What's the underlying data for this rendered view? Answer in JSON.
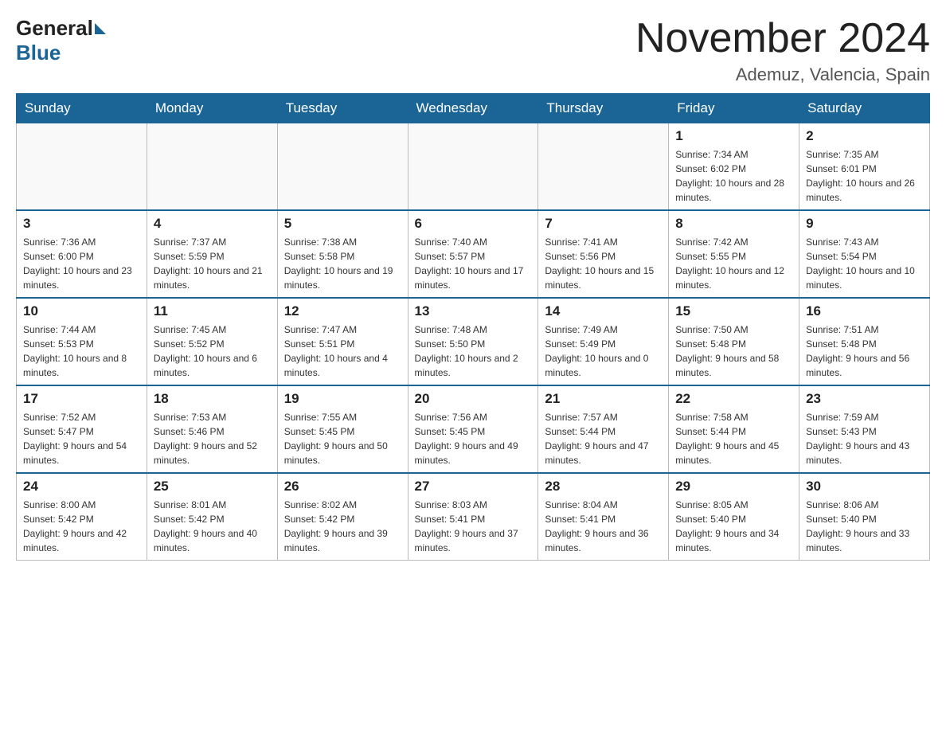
{
  "header": {
    "logo_general": "General",
    "logo_blue": "Blue",
    "title": "November 2024",
    "subtitle": "Ademuz, Valencia, Spain"
  },
  "days_of_week": [
    "Sunday",
    "Monday",
    "Tuesday",
    "Wednesday",
    "Thursday",
    "Friday",
    "Saturday"
  ],
  "weeks": [
    [
      {
        "day": "",
        "info": ""
      },
      {
        "day": "",
        "info": ""
      },
      {
        "day": "",
        "info": ""
      },
      {
        "day": "",
        "info": ""
      },
      {
        "day": "",
        "info": ""
      },
      {
        "day": "1",
        "info": "Sunrise: 7:34 AM\nSunset: 6:02 PM\nDaylight: 10 hours and 28 minutes."
      },
      {
        "day": "2",
        "info": "Sunrise: 7:35 AM\nSunset: 6:01 PM\nDaylight: 10 hours and 26 minutes."
      }
    ],
    [
      {
        "day": "3",
        "info": "Sunrise: 7:36 AM\nSunset: 6:00 PM\nDaylight: 10 hours and 23 minutes."
      },
      {
        "day": "4",
        "info": "Sunrise: 7:37 AM\nSunset: 5:59 PM\nDaylight: 10 hours and 21 minutes."
      },
      {
        "day": "5",
        "info": "Sunrise: 7:38 AM\nSunset: 5:58 PM\nDaylight: 10 hours and 19 minutes."
      },
      {
        "day": "6",
        "info": "Sunrise: 7:40 AM\nSunset: 5:57 PM\nDaylight: 10 hours and 17 minutes."
      },
      {
        "day": "7",
        "info": "Sunrise: 7:41 AM\nSunset: 5:56 PM\nDaylight: 10 hours and 15 minutes."
      },
      {
        "day": "8",
        "info": "Sunrise: 7:42 AM\nSunset: 5:55 PM\nDaylight: 10 hours and 12 minutes."
      },
      {
        "day": "9",
        "info": "Sunrise: 7:43 AM\nSunset: 5:54 PM\nDaylight: 10 hours and 10 minutes."
      }
    ],
    [
      {
        "day": "10",
        "info": "Sunrise: 7:44 AM\nSunset: 5:53 PM\nDaylight: 10 hours and 8 minutes."
      },
      {
        "day": "11",
        "info": "Sunrise: 7:45 AM\nSunset: 5:52 PM\nDaylight: 10 hours and 6 minutes."
      },
      {
        "day": "12",
        "info": "Sunrise: 7:47 AM\nSunset: 5:51 PM\nDaylight: 10 hours and 4 minutes."
      },
      {
        "day": "13",
        "info": "Sunrise: 7:48 AM\nSunset: 5:50 PM\nDaylight: 10 hours and 2 minutes."
      },
      {
        "day": "14",
        "info": "Sunrise: 7:49 AM\nSunset: 5:49 PM\nDaylight: 10 hours and 0 minutes."
      },
      {
        "day": "15",
        "info": "Sunrise: 7:50 AM\nSunset: 5:48 PM\nDaylight: 9 hours and 58 minutes."
      },
      {
        "day": "16",
        "info": "Sunrise: 7:51 AM\nSunset: 5:48 PM\nDaylight: 9 hours and 56 minutes."
      }
    ],
    [
      {
        "day": "17",
        "info": "Sunrise: 7:52 AM\nSunset: 5:47 PM\nDaylight: 9 hours and 54 minutes."
      },
      {
        "day": "18",
        "info": "Sunrise: 7:53 AM\nSunset: 5:46 PM\nDaylight: 9 hours and 52 minutes."
      },
      {
        "day": "19",
        "info": "Sunrise: 7:55 AM\nSunset: 5:45 PM\nDaylight: 9 hours and 50 minutes."
      },
      {
        "day": "20",
        "info": "Sunrise: 7:56 AM\nSunset: 5:45 PM\nDaylight: 9 hours and 49 minutes."
      },
      {
        "day": "21",
        "info": "Sunrise: 7:57 AM\nSunset: 5:44 PM\nDaylight: 9 hours and 47 minutes."
      },
      {
        "day": "22",
        "info": "Sunrise: 7:58 AM\nSunset: 5:44 PM\nDaylight: 9 hours and 45 minutes."
      },
      {
        "day": "23",
        "info": "Sunrise: 7:59 AM\nSunset: 5:43 PM\nDaylight: 9 hours and 43 minutes."
      }
    ],
    [
      {
        "day": "24",
        "info": "Sunrise: 8:00 AM\nSunset: 5:42 PM\nDaylight: 9 hours and 42 minutes."
      },
      {
        "day": "25",
        "info": "Sunrise: 8:01 AM\nSunset: 5:42 PM\nDaylight: 9 hours and 40 minutes."
      },
      {
        "day": "26",
        "info": "Sunrise: 8:02 AM\nSunset: 5:42 PM\nDaylight: 9 hours and 39 minutes."
      },
      {
        "day": "27",
        "info": "Sunrise: 8:03 AM\nSunset: 5:41 PM\nDaylight: 9 hours and 37 minutes."
      },
      {
        "day": "28",
        "info": "Sunrise: 8:04 AM\nSunset: 5:41 PM\nDaylight: 9 hours and 36 minutes."
      },
      {
        "day": "29",
        "info": "Sunrise: 8:05 AM\nSunset: 5:40 PM\nDaylight: 9 hours and 34 minutes."
      },
      {
        "day": "30",
        "info": "Sunrise: 8:06 AM\nSunset: 5:40 PM\nDaylight: 9 hours and 33 minutes."
      }
    ]
  ]
}
